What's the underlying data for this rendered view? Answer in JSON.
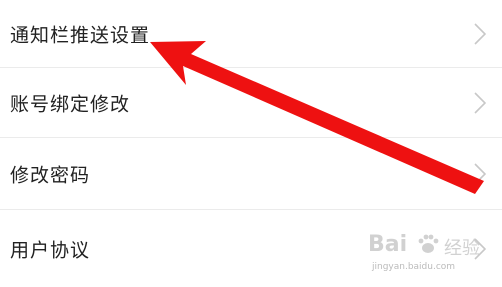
{
  "settings": {
    "items": [
      {
        "label": "通知栏推送设置"
      },
      {
        "label": "账号绑定修改"
      },
      {
        "label": "修改密码"
      },
      {
        "label": "用户协议"
      }
    ]
  },
  "annotation": {
    "arrow_color": "#ee1111"
  },
  "watermark": {
    "brand": "Bai",
    "label": "经验",
    "url": "jingyan.baidu.com"
  },
  "icons": {
    "row_chevron": "chevron-right-icon",
    "watermark_logo": "baidu-paw-icon"
  }
}
